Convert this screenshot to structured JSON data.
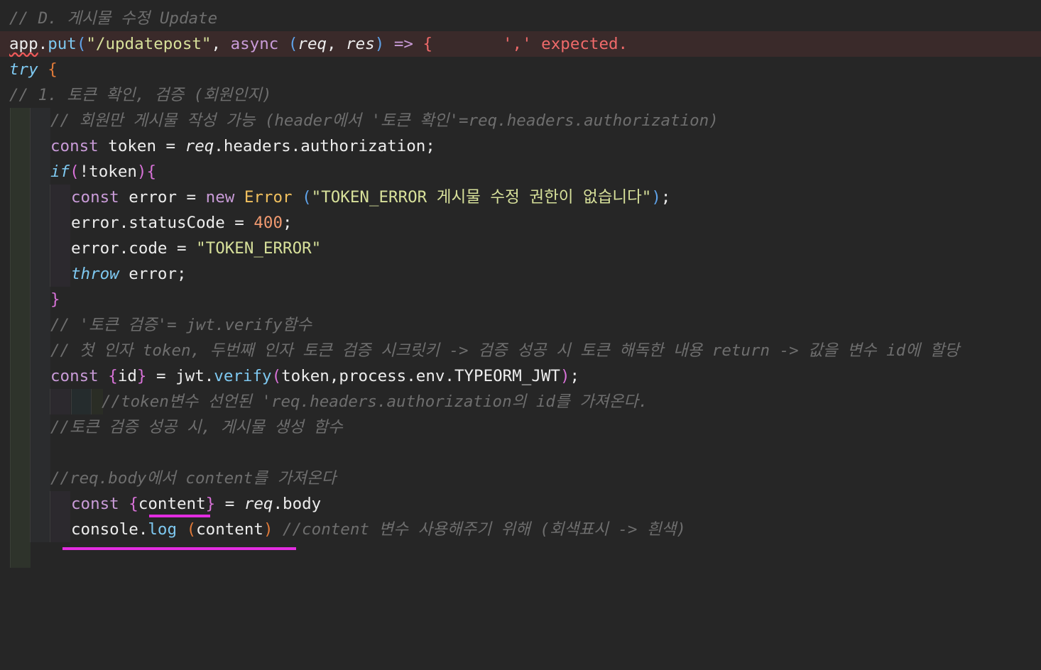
{
  "editor": {
    "lines": [
      "// D. 게시물 수정 Update",
      "app.put(\"/updatepost\", async (req, res) => {",
      "try {",
      "// 1. 토큰 확인, 검증 (회원인지)",
      "// 회원만 게시물 작성 가능 (header에서 '토큰 확인'=req.headers.authorization)",
      "const token = req.headers.authorization;",
      "if(!token){",
      "const error = new Error (\"TOKEN_ERROR 게시물 수정 권한이 없습니다\");",
      "error.statusCode = 400;",
      "error.code = \"TOKEN_ERROR\"",
      "throw error;",
      "}",
      "// '토큰 검증'= jwt.verify함수",
      "// 첫 인자 token, 두번째 인자 토큰 검증 시크릿키 -> 검증 성공 시 토큰 해독한 내용 return -> 값을 변수 id에 할당",
      "const {id} = jwt.verify(token,process.env.TYPEORM_JWT);",
      "//token변수 선언된 'req.headers.authorization의 id를 가져온다.",
      "//토큰 검증 성공 시, 게시물 생성 함수",
      "",
      "//req.body에서 content를 가져온다",
      "const {content} = req.body",
      "console.log (content) //content 변수 사용해주기 위해 (회색표시 -> 흰색)"
    ],
    "diagnostic": "',' expected.",
    "colors": {
      "background": "#262626",
      "comment": "#6e6e6e",
      "keyword": "#c99bd8",
      "function": "#7ec8f0",
      "string": "#d7e09a",
      "number": "#f19a70",
      "class": "#f1c05e",
      "error": "#ef6a6a",
      "marker": "#e22de0"
    }
  }
}
